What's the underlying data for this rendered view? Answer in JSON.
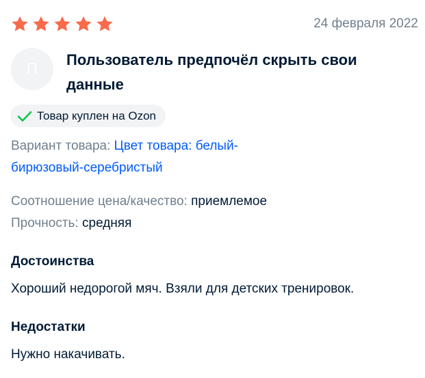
{
  "rating": {
    "stars": 5,
    "max": 5,
    "color": "#f96a4b"
  },
  "date": "24 февраля 2022",
  "author": {
    "avatar_initial": "П",
    "name": "Пользователь предпочёл скрыть свои данные"
  },
  "badge": {
    "icon": "check-icon",
    "label": "Товар куплен на Ozon",
    "icon_color": "#10c44c"
  },
  "variant": {
    "label": "Вариант товара:",
    "value": "Цвет товара: белый-бирюзовый-серебристый"
  },
  "attributes": [
    {
      "label": "Соотношение цена/качество:",
      "value": "приемлемое"
    },
    {
      "label": "Прочность:",
      "value": "средняя"
    }
  ],
  "pros": {
    "title": "Достоинства",
    "text": "Хороший недорогой мяч. Взяли для детских тренировок."
  },
  "cons": {
    "title": "Недостатки",
    "text": "Нужно накачивать."
  },
  "colors": {
    "text": "#001a34",
    "muted": "#707f8d",
    "link": "#005bff",
    "badge_bg": "#f2f3f5"
  }
}
